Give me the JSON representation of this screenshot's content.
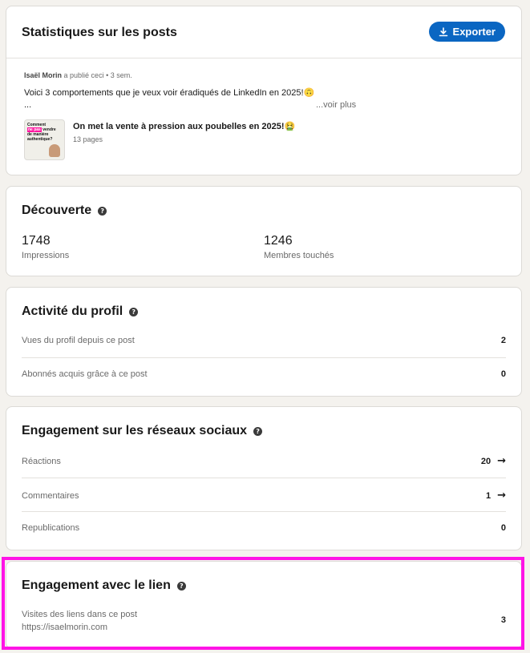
{
  "header": {
    "title": "Statistiques sur les posts",
    "export_label": "Exporter",
    "export_icon": "download-icon",
    "author": "Isaël Morin",
    "action": "a publié ceci",
    "time": "3 sem.",
    "post_text": "Voici 3 comportements que je veux voir éradiqués de LinkedIn en 2025!🙃",
    "ellipsis": "...",
    "see_more": "...voir plus",
    "doc_title": "On met la vente à pression aux poubelles en 2025!🤮",
    "doc_pages": "13 pages",
    "thumb_line1": "Comment",
    "thumb_line2": "ne pas",
    "thumb_line3": "vendre",
    "thumb_line4": "de manière",
    "thumb_line5": "authentique?"
  },
  "discovery": {
    "title": "Découverte",
    "impressions_value": "1748",
    "impressions_label": "Impressions",
    "members_value": "1246",
    "members_label": "Membres touchés"
  },
  "profile": {
    "title": "Activité du profil",
    "rows": [
      {
        "label": "Vues du profil depuis ce post",
        "value": "2"
      },
      {
        "label": "Abonnés acquis grâce à ce post",
        "value": "0"
      }
    ]
  },
  "social": {
    "title": "Engagement sur les réseaux sociaux",
    "rows": [
      {
        "label": "Réactions",
        "value": "20"
      },
      {
        "label": "Commentaires",
        "value": "1"
      },
      {
        "label": "Republications",
        "value": "0"
      }
    ]
  },
  "link": {
    "title": "Engagement avec le lien",
    "label": "Visites des liens dans ce post",
    "url": "https://isaelmorin.com",
    "value": "3"
  },
  "colors": {
    "accent": "#0a66c2",
    "highlight": "#ff14e6"
  }
}
